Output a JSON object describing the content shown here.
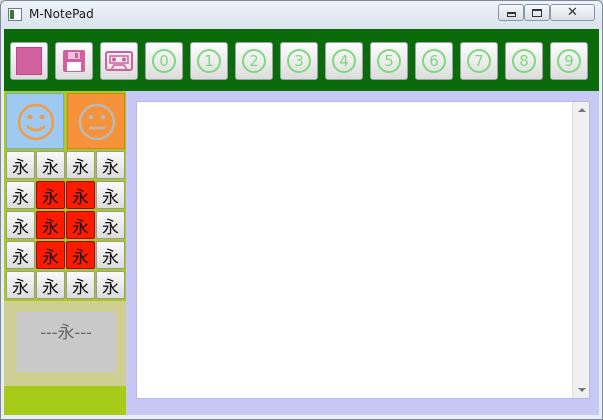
{
  "window": {
    "title": "M-NotePad"
  },
  "toolbar": {
    "numbers": [
      "0",
      "1",
      "2",
      "3",
      "4",
      "5",
      "6",
      "7",
      "8",
      "9"
    ],
    "swatch_color": "#d0619e",
    "icons": [
      "color-swatch-icon",
      "floppy-disk-icon",
      "cassette-icon"
    ]
  },
  "moods": [
    {
      "name": "happy-face-icon",
      "bg": "#9ec9f0"
    },
    {
      "name": "neutral-face-icon",
      "bg": "#f6923a"
    }
  ],
  "glyph_grid": {
    "char": "永",
    "rows": [
      [
        {
          "c": "永",
          "red": false
        },
        {
          "c": "永",
          "red": false
        },
        {
          "c": "永",
          "red": false
        },
        {
          "c": "永",
          "red": false
        }
      ],
      [
        {
          "c": "永",
          "red": false
        },
        {
          "c": "永",
          "red": true
        },
        {
          "c": "永",
          "red": true
        },
        {
          "c": "永",
          "red": false
        }
      ],
      [
        {
          "c": "永",
          "red": false
        },
        {
          "c": "永",
          "red": true
        },
        {
          "c": "永",
          "red": true
        },
        {
          "c": "永",
          "red": false
        }
      ],
      [
        {
          "c": "永",
          "red": false
        },
        {
          "c": "永",
          "red": true
        },
        {
          "c": "永",
          "red": true
        },
        {
          "c": "永",
          "red": false
        }
      ],
      [
        {
          "c": "永",
          "red": false
        },
        {
          "c": "永",
          "red": false
        },
        {
          "c": "永",
          "red": false
        },
        {
          "c": "永",
          "red": false
        }
      ]
    ]
  },
  "preview": {
    "text": "---永---"
  },
  "editor": {
    "content": ""
  }
}
